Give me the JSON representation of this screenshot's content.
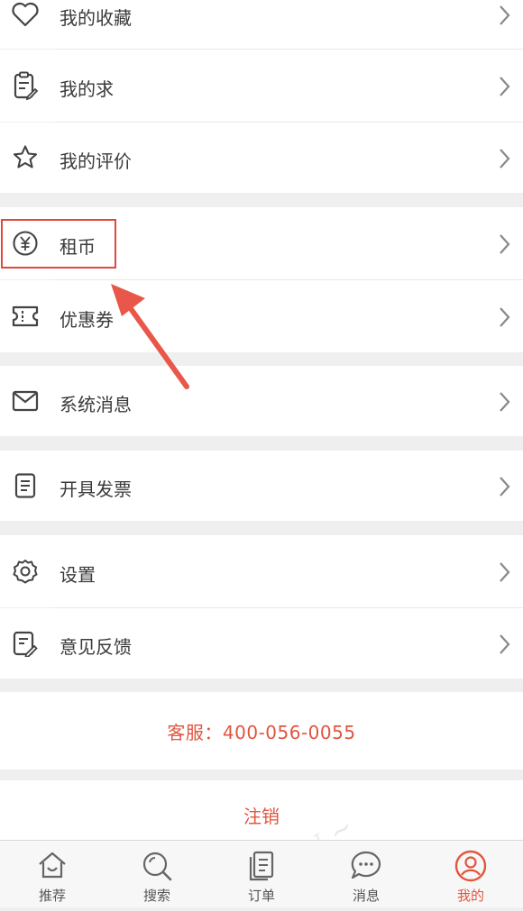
{
  "menu": {
    "favorites": "我的收藏",
    "requests": "我的求",
    "reviews": "我的评价",
    "coins": "租币",
    "coupons": "优惠券",
    "messages": "系统消息",
    "invoice": "开具发票",
    "settings": "设置",
    "feedback": "意见反馈"
  },
  "service_line": "客服：400-056-0055",
  "logout_label": "注销",
  "tabbar": {
    "recommend": "推荐",
    "search": "搜索",
    "orders": "订单",
    "messages": "消息",
    "mine": "我的"
  },
  "colors": {
    "accent": "#e2553e",
    "highlight_box": "#e0473d",
    "background": "#efefef"
  },
  "icons": {
    "favorites": "heart-icon",
    "requests": "clipboard-edit-icon",
    "reviews": "star-icon",
    "coins": "yuan-coin-icon",
    "coupons": "ticket-icon",
    "messages": "mail-icon",
    "invoice": "document-icon",
    "settings": "gear-icon",
    "feedback": "edit-note-icon"
  }
}
